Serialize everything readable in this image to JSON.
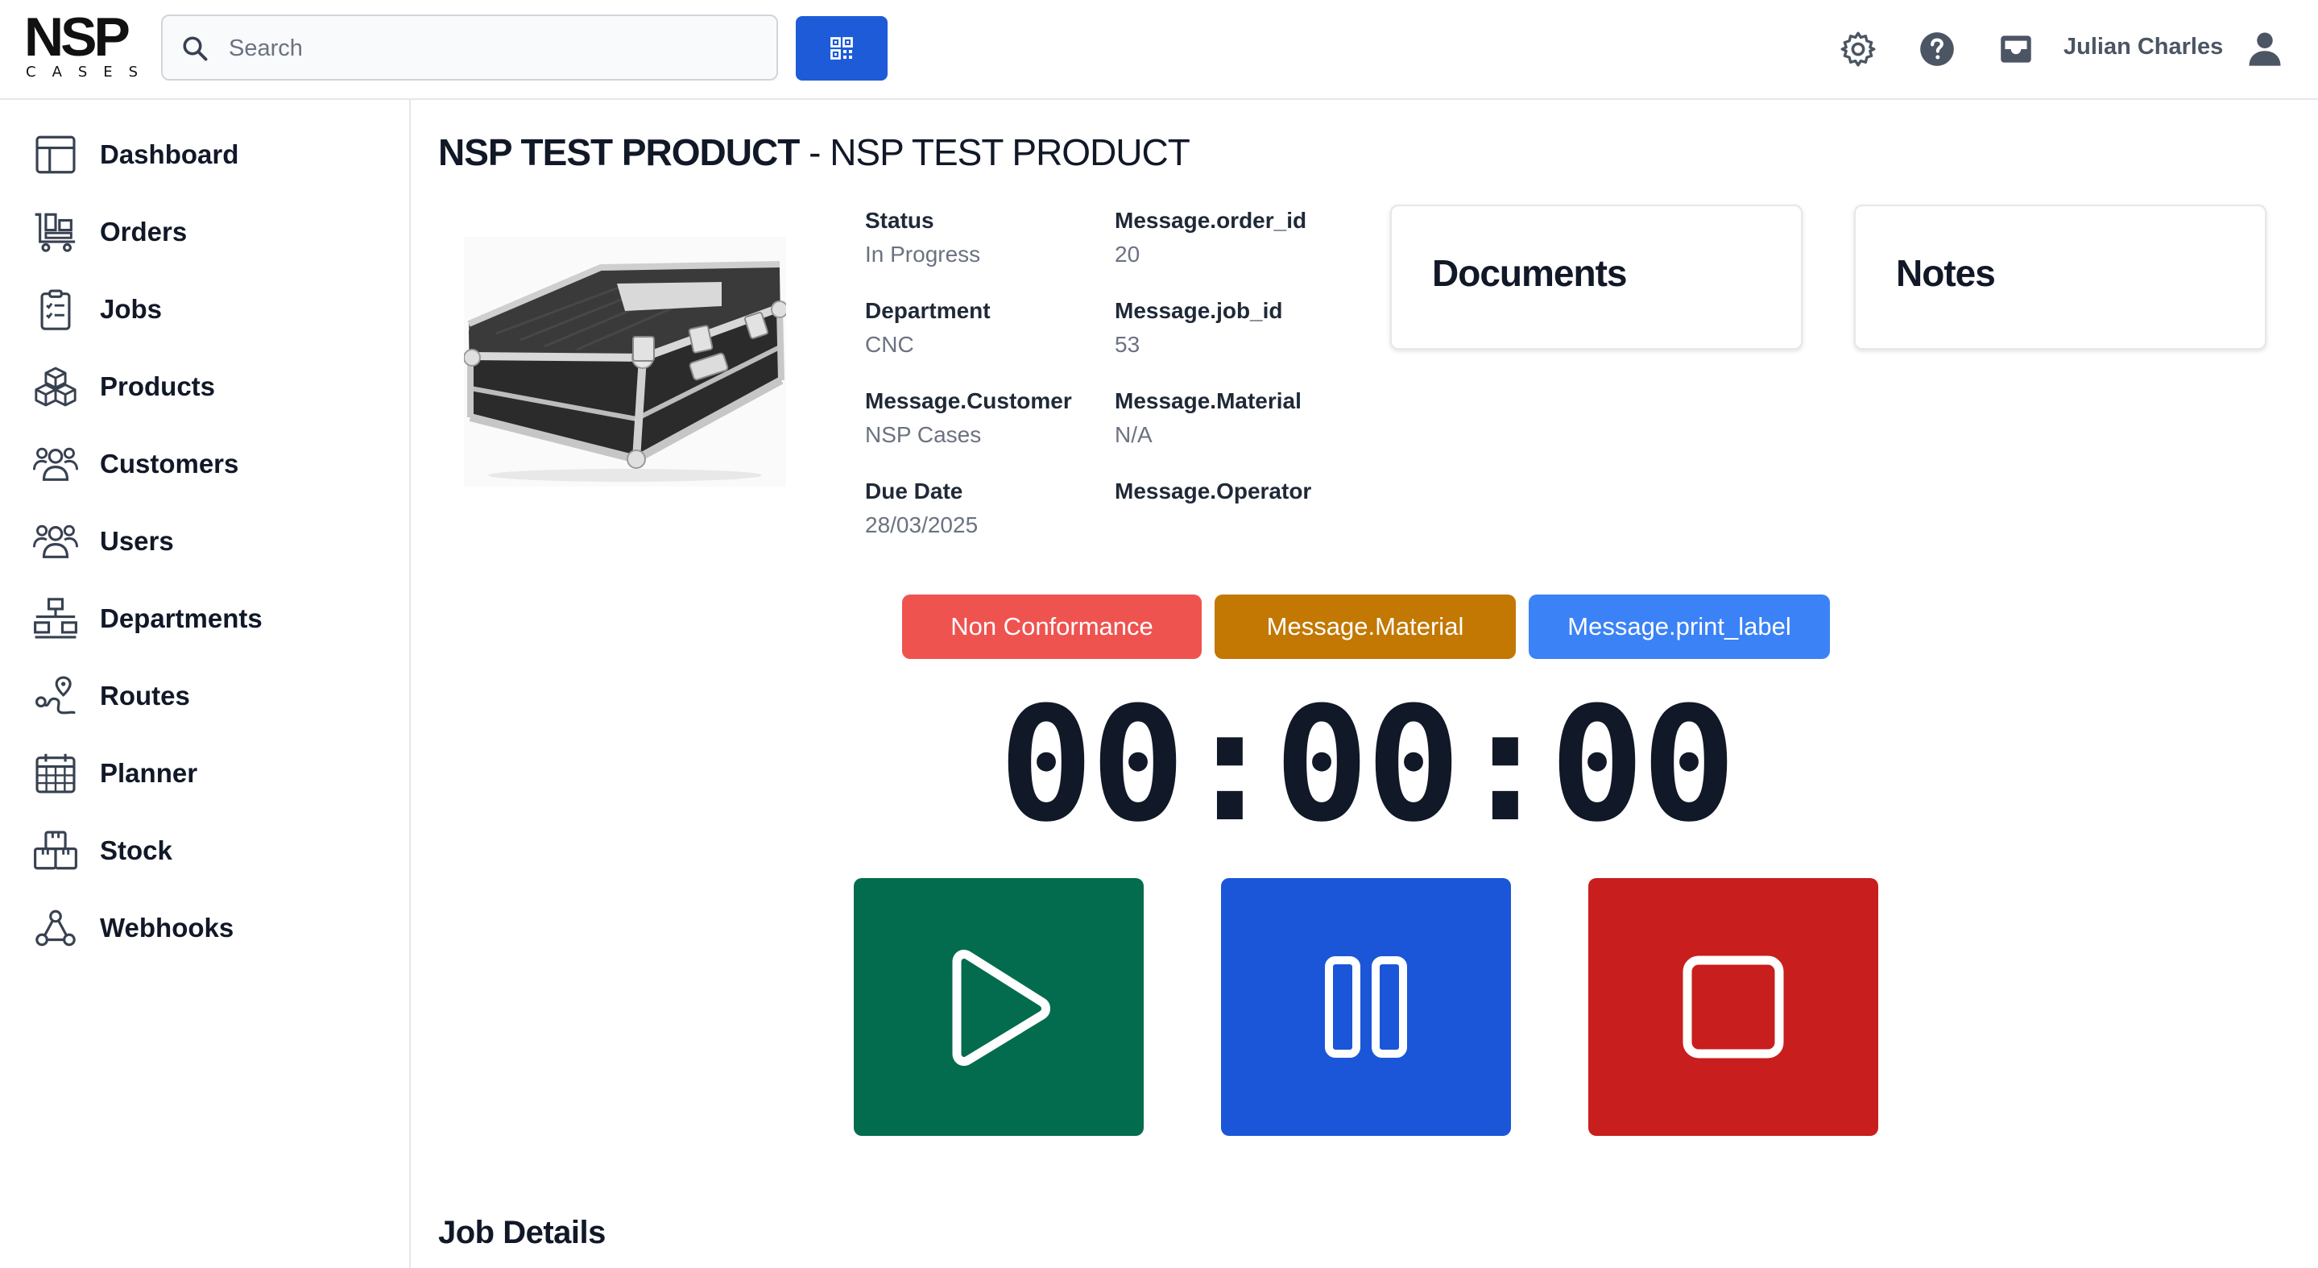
{
  "app": {
    "logo_text": "NSP",
    "logo_subtext": "CASES"
  },
  "header": {
    "search": {
      "placeholder": "Search",
      "icon": "search-icon"
    },
    "qr_button_icon": "qr-code-icon",
    "icons": [
      "settings-icon",
      "help-icon",
      "inbox-icon",
      "user-icon"
    ],
    "user_name": "Julian Charles",
    "accent_color": "#1d5bd8"
  },
  "sidebar": {
    "items": [
      {
        "label": "Dashboard",
        "icon": "dashboard-icon"
      },
      {
        "label": "Orders",
        "icon": "orders-icon"
      },
      {
        "label": "Jobs",
        "icon": "jobs-icon"
      },
      {
        "label": "Products",
        "icon": "products-icon"
      },
      {
        "label": "Customers",
        "icon": "customers-icon"
      },
      {
        "label": "Users",
        "icon": "users-icon"
      },
      {
        "label": "Departments",
        "icon": "departments-icon"
      },
      {
        "label": "Routes",
        "icon": "routes-icon"
      },
      {
        "label": "Planner",
        "icon": "planner-icon"
      },
      {
        "label": "Stock",
        "icon": "stock-icon"
      },
      {
        "label": "Webhooks",
        "icon": "webhooks-icon"
      }
    ]
  },
  "main": {
    "title_primary": "NSP TEST PRODUCT",
    "title_secondary": "- NSP TEST PRODUCT",
    "details": [
      {
        "label": "Status",
        "value": "In Progress"
      },
      {
        "label": "Message.order_id",
        "value": "20"
      },
      {
        "label": "Department",
        "value": "CNC"
      },
      {
        "label": "Message.job_id",
        "value": "53"
      },
      {
        "label": "Message.Customer",
        "value": "NSP Cases"
      },
      {
        "label": "Message.Material",
        "value": "N/A"
      },
      {
        "label": "Due Date",
        "value": "28/03/2025"
      },
      {
        "label": "Message.Operator",
        "value": ""
      }
    ],
    "cards": {
      "documents": "Documents",
      "notes": "Notes"
    },
    "actions": {
      "non_conformance": "Non Conformance",
      "material": "Message.Material",
      "print_label": "Message.print_label"
    },
    "action_colors": {
      "non_conformance": "#ef5350",
      "material": "#c27803",
      "print_label": "#3b82f6"
    },
    "timer": "00:00:00",
    "controls": {
      "play_color": "#046c4e",
      "pause_color": "#1c56d8",
      "stop_color": "#c81e1e"
    },
    "section_heading": "Job Details"
  }
}
